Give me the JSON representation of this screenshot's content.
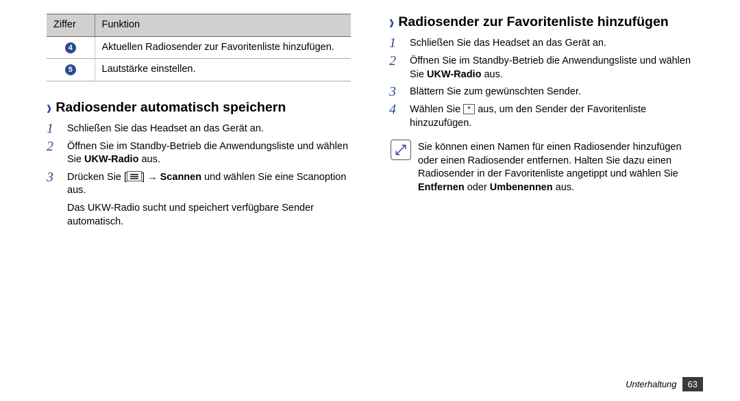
{
  "table": {
    "head": {
      "c1": "Ziffer",
      "c2": "Funktion"
    },
    "rows": [
      {
        "num": "4",
        "text": "Aktuellen Radiosender zur Favoritenliste hinzufügen."
      },
      {
        "num": "5",
        "text": "Lautstärke einstellen."
      }
    ]
  },
  "left": {
    "heading": "Radiosender automatisch speichern",
    "steps": {
      "s1": "Schließen Sie das Headset an das Gerät an.",
      "s2a": "Öffnen Sie im Standby-Betrieb die Anwendungsliste und wählen Sie ",
      "s2b": "UKW-Radio",
      "s2c": " aus.",
      "s3a": "Drücken Sie [",
      "s3b": "] → ",
      "s3c": "Scannen",
      "s3d": " und wählen Sie eine Scanoption aus."
    },
    "after": "Das UKW-Radio sucht und speichert verfügbare Sender automatisch."
  },
  "right": {
    "heading": "Radiosender zur Favoritenliste hinzufügen",
    "steps": {
      "s1": "Schließen Sie das Headset an das Gerät an.",
      "s2a": "Öffnen Sie im Standby-Betrieb die Anwendungsliste und wählen Sie ",
      "s2b": "UKW-Radio",
      "s2c": " aus.",
      "s3": "Blättern Sie zum gewünschten Sender.",
      "s4a": "Wählen Sie ",
      "s4b": " aus, um den Sender der Favoritenliste hinzuzufügen."
    },
    "note": {
      "t1": "Sie können einen Namen für einen Radiosender hinzufügen oder einen Radiosender entfernen. Halten Sie dazu einen Radiosender in der Favoritenliste angetippt und wählen Sie ",
      "t2": "Entfernen",
      "t3": " oder ",
      "t4": "Umbenennen",
      "t5": " aus."
    }
  },
  "footer": {
    "section": "Unterhaltung",
    "page": "63"
  }
}
